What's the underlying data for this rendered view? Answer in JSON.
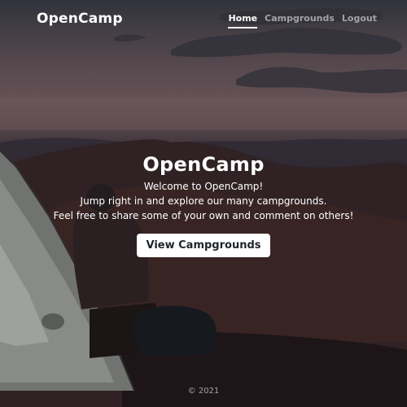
{
  "navbar": {
    "brand": "OpenCamp",
    "links": [
      {
        "label": "Home",
        "active": true
      },
      {
        "label": "Campgrounds",
        "active": false
      },
      {
        "label": "Logout",
        "active": false
      }
    ]
  },
  "hero": {
    "title": "OpenCamp",
    "lines": [
      "Welcome to OpenCamp!",
      "Jump right in and explore our many campgrounds.",
      "Feel free to share some of your own and comment on others!"
    ],
    "cta_label": "View Campgrounds"
  },
  "footer": {
    "text": "© 2021"
  },
  "colors": {
    "text": "#ffffff",
    "button_bg": "#ffffff",
    "button_text": "#212529"
  }
}
